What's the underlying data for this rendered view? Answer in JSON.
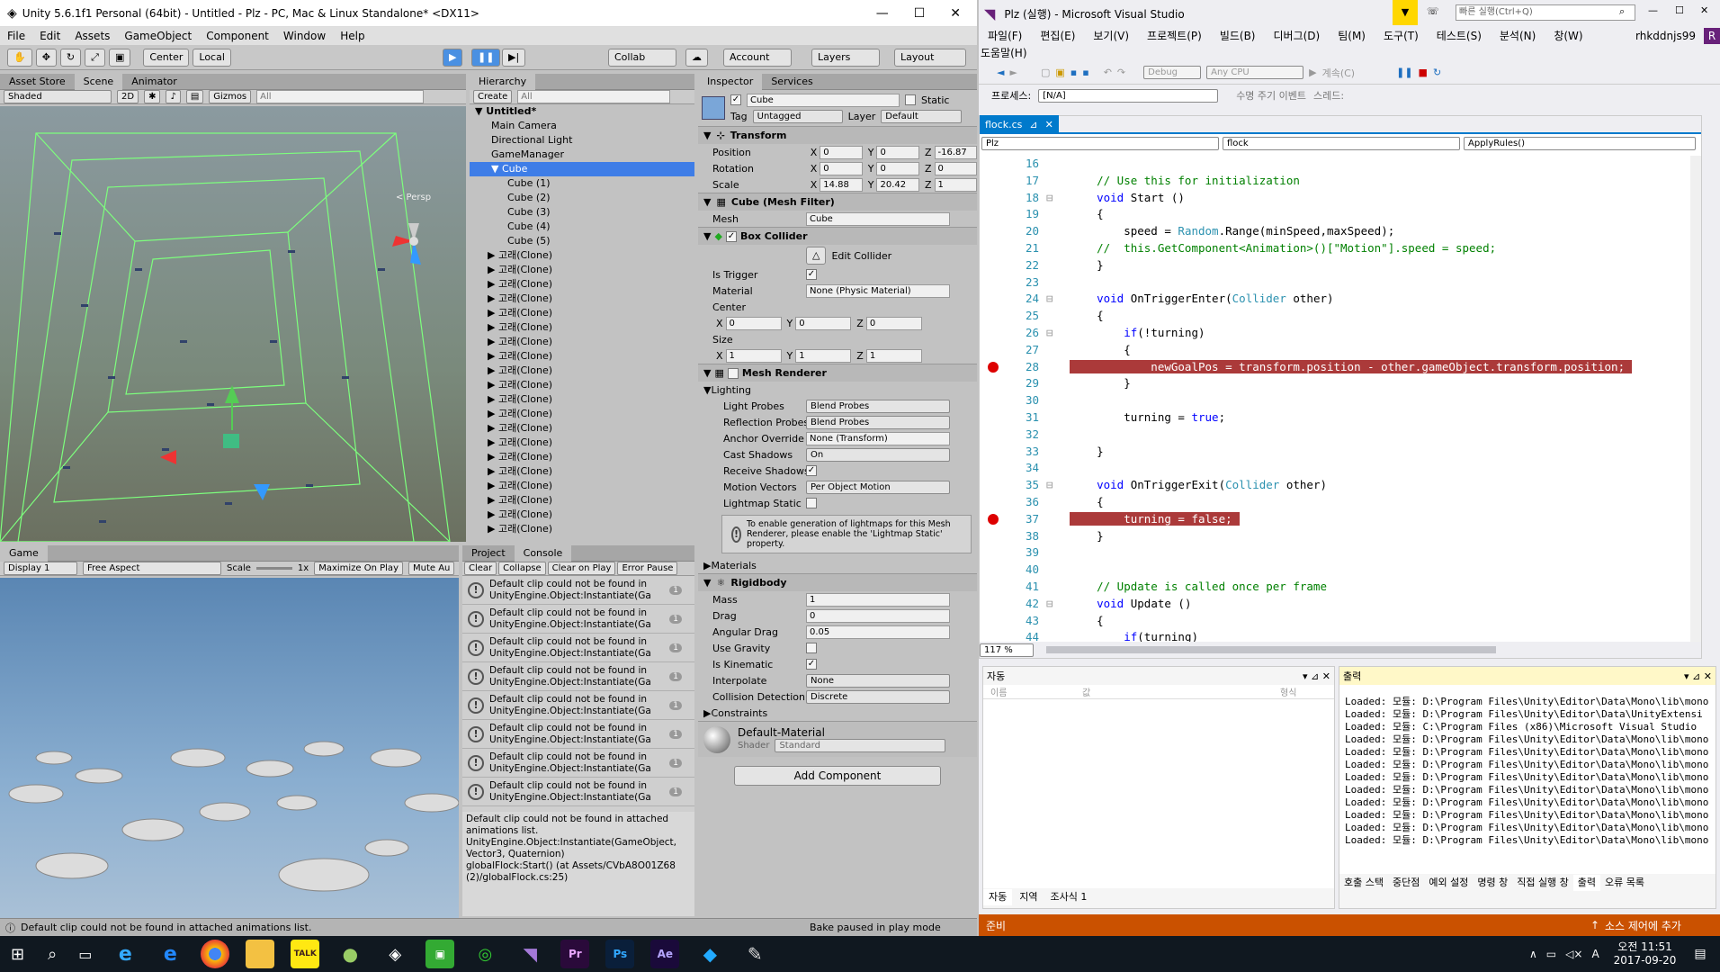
{
  "unity": {
    "title": "Unity 5.6.1f1 Personal (64bit) - Untitled - Plz - PC, Mac & Linux Standalone* <DX11>",
    "menu": [
      "File",
      "Edit",
      "Assets",
      "GameObject",
      "Component",
      "Window",
      "Help"
    ],
    "toolbar": {
      "center": "Center",
      "local": "Local",
      "collab": "Collab",
      "account": "Account",
      "layers": "Layers",
      "layout": "Layout"
    },
    "scene": {
      "tabs": [
        "Asset Store",
        "Scene",
        "Animator"
      ],
      "shaded": "Shaded",
      "mode2d": "2D",
      "gizmos": "Gizmos",
      "search_ph": "All",
      "persp": "< Persp"
    },
    "game": {
      "tab": "Game",
      "display": "Display 1",
      "aspect": "Free Aspect",
      "scale_label": "Scale",
      "scale_val": "1x",
      "max": "Maximize On Play",
      "mute": "Mute Au"
    },
    "hierarchy": {
      "tab": "Hierarchy",
      "create": "Create",
      "search_ph": "All",
      "scene": "Untitled*",
      "items": [
        "Main Camera",
        "Directional Light",
        "GameManager",
        "Cube",
        "Cube (1)",
        "Cube (2)",
        "Cube (3)",
        "Cube (4)",
        "Cube (5)",
        "고래(Clone)",
        "고래(Clone)",
        "고래(Clone)",
        "고래(Clone)",
        "고래(Clone)",
        "고래(Clone)",
        "고래(Clone)",
        "고래(Clone)",
        "고래(Clone)",
        "고래(Clone)",
        "고래(Clone)",
        "고래(Clone)",
        "고래(Clone)",
        "고래(Clone)",
        "고래(Clone)",
        "고래(Clone)",
        "고래(Clone)",
        "고래(Clone)",
        "고래(Clone)",
        "고래(Clone)"
      ]
    },
    "console": {
      "tabs": [
        "Project",
        "Console"
      ],
      "buttons": [
        "Clear",
        "Collapse",
        "Clear on Play",
        "Error Pause"
      ],
      "entries": [
        {
          "l1": "Default clip could not be found in",
          "l2": "UnityEngine.Object:Instantiate(Ga",
          "n": "1"
        },
        {
          "l1": "Default clip could not be found in",
          "l2": "UnityEngine.Object:Instantiate(Ga",
          "n": "1"
        },
        {
          "l1": "Default clip could not be found in",
          "l2": "UnityEngine.Object:Instantiate(Ga",
          "n": "1"
        },
        {
          "l1": "Default clip could not be found in",
          "l2": "UnityEngine.Object:Instantiate(Ga",
          "n": "1"
        },
        {
          "l1": "Default clip could not be found in",
          "l2": "UnityEngine.Object:Instantiate(Ga",
          "n": "1"
        },
        {
          "l1": "Default clip could not be found in",
          "l2": "UnityEngine.Object:Instantiate(Ga",
          "n": "1"
        },
        {
          "l1": "Default clip could not be found in",
          "l2": "UnityEngine.Object:Instantiate(Ga",
          "n": "1"
        },
        {
          "l1": "Default clip could not be found in",
          "l2": "UnityEngine.Object:Instantiate(Ga",
          "n": "1"
        }
      ],
      "detail": [
        "Default clip could not be found in attached",
        "animations list.",
        "UnityEngine.Object:Instantiate(GameObject,",
        "Vector3, Quaternion)",
        "globalFlock:Start() (at Assets/CVbA8O01Z68",
        "(2)/globalFlock.cs:25)"
      ]
    },
    "inspector": {
      "tabs": [
        "Inspector",
        "Services"
      ],
      "name": "Cube",
      "static": "Static",
      "tag_label": "Tag",
      "tag": "Untagged",
      "layer_label": "Layer",
      "layer": "Default",
      "transform": {
        "title": "Transform",
        "pos_label": "Position",
        "rot_label": "Rotation",
        "scale_label": "Scale",
        "pos": [
          "0",
          "0",
          "-16.87"
        ],
        "rot": [
          "0",
          "0",
          "0"
        ],
        "scale": [
          "14.88",
          "20.42",
          "1"
        ]
      },
      "meshfilter": {
        "title": "Cube (Mesh Filter)",
        "mesh_label": "Mesh",
        "mesh": "Cube"
      },
      "boxcollider": {
        "title": "Box Collider",
        "edit": "Edit Collider",
        "trigger_label": "Is Trigger",
        "material_label": "Material",
        "material": "None (Physic Material)",
        "center_label": "Center",
        "center": [
          "0",
          "0",
          "0"
        ],
        "size_label": "Size",
        "size": [
          "1",
          "1",
          "1"
        ]
      },
      "meshrenderer": {
        "title": "Mesh Renderer",
        "lighting": "Lighting",
        "lp_label": "Light Probes",
        "lp": "Blend Probes",
        "rp_label": "Reflection Probes",
        "rp": "Blend Probes",
        "ao_label": "Anchor Override",
        "ao": "None (Transform)",
        "cs_label": "Cast Shadows",
        "cs": "On",
        "rs_label": "Receive Shadows",
        "mv_label": "Motion Vectors",
        "mv": "Per Object Motion",
        "ls_label": "Lightmap Static",
        "info": "To enable generation of lightmaps for this Mesh Renderer, please enable the 'Lightmap Static' property.",
        "materials": "Materials"
      },
      "rigidbody": {
        "title": "Rigidbody",
        "mass_label": "Mass",
        "mass": "1",
        "drag_label": "Drag",
        "drag": "0",
        "adrag_label": "Angular Drag",
        "adrag": "0.05",
        "grav_label": "Use Gravity",
        "kin_label": "Is Kinematic",
        "interp_label": "Interpolate",
        "interp": "None",
        "cd_label": "Collision Detection",
        "cd": "Discrete",
        "constraints": "Constraints"
      },
      "material": {
        "name": "Default-Material",
        "shader_label": "Shader",
        "shader": "Standard"
      },
      "add": "Add Component"
    },
    "status": {
      "msg": "Default clip could not be found in attached animations list.",
      "bake": "Bake paused in play mode"
    }
  },
  "vs": {
    "title": "Plz (실행) - Microsoft Visual Studio",
    "quick_ph": "빠른 실행(Ctrl+Q)",
    "user": "rhkddnjs99",
    "menu": [
      "파일(F)",
      "편집(E)",
      "보기(V)",
      "프로젝트(P)",
      "빌드(B)",
      "디버그(D)",
      "팀(M)",
      "도구(T)",
      "테스트(S)",
      "분석(N)",
      "창(W)"
    ],
    "menu2": "도움말(H)",
    "toolbar": {
      "config": "Debug",
      "platform": "Any CPU",
      "continue": "계속(C)"
    },
    "process": {
      "label": "프로세스:",
      "value": "[N/A]",
      "lifecycle": "수명 주기 이벤트",
      "thread": "스레드:"
    },
    "tab": "flock.cs",
    "nav": {
      "project": "Plz",
      "class": "flock",
      "method": "ApplyRules()"
    },
    "zoom": "117 %",
    "code": [
      {
        "n": "16",
        "t": ""
      },
      {
        "n": "17",
        "t": "    // Use this for initialization"
      },
      {
        "n": "18",
        "t": "    void Start ()"
      },
      {
        "n": "19",
        "t": "    {"
      },
      {
        "n": "20",
        "t": "        speed = Random.Range(minSpeed,maxSpeed);"
      },
      {
        "n": "21",
        "t": "    //  this.GetComponent<Animation>()[\"Motion\"].speed = speed;"
      },
      {
        "n": "22",
        "t": "    }"
      },
      {
        "n": "23",
        "t": ""
      },
      {
        "n": "24",
        "t": "    void OnTriggerEnter(Collider other)"
      },
      {
        "n": "25",
        "t": "    {"
      },
      {
        "n": "26",
        "t": "        if(!turning)"
      },
      {
        "n": "27",
        "t": "        {"
      },
      {
        "n": "28",
        "t": "            newGoalPos = transform.position - other.gameObject.transform.position;"
      },
      {
        "n": "29",
        "t": "        }"
      },
      {
        "n": "30",
        "t": ""
      },
      {
        "n": "31",
        "t": "        turning = true;"
      },
      {
        "n": "32",
        "t": ""
      },
      {
        "n": "33",
        "t": "    }"
      },
      {
        "n": "34",
        "t": ""
      },
      {
        "n": "35",
        "t": "    void OnTriggerExit(Collider other)"
      },
      {
        "n": "36",
        "t": "    {"
      },
      {
        "n": "37",
        "t": "        turning = false;"
      },
      {
        "n": "38",
        "t": "    }"
      },
      {
        "n": "39",
        "t": ""
      },
      {
        "n": "40",
        "t": ""
      },
      {
        "n": "41",
        "t": "    // Update is called once per frame"
      },
      {
        "n": "42",
        "t": "    void Update ()"
      },
      {
        "n": "43",
        "t": "    {"
      },
      {
        "n": "44",
        "t": "        if(turning)"
      }
    ],
    "auto": {
      "title": "자동",
      "cols": [
        "이름",
        "값",
        "형식"
      ],
      "tabs": [
        "자동",
        "지역",
        "조사식 1"
      ]
    },
    "output": {
      "title": "출력",
      "lines": [
        "Loaded: 모듈: D:\\Program Files\\Unity\\Editor\\Data\\Mono\\lib\\mono",
        "Loaded: 모듈: D:\\Program Files\\Unity\\Editor\\Data\\UnityExtensi",
        "Loaded: 모듈: C:\\Program Files (x86)\\Microsoft Visual Studio",
        "Loaded: 모듈: D:\\Program Files\\Unity\\Editor\\Data\\Mono\\lib\\mono",
        "Loaded: 모듈: D:\\Program Files\\Unity\\Editor\\Data\\Mono\\lib\\mono",
        "Loaded: 모듈: D:\\Program Files\\Unity\\Editor\\Data\\Mono\\lib\\mono",
        "Loaded: 모듈: D:\\Program Files\\Unity\\Editor\\Data\\Mono\\lib\\mono",
        "Loaded: 모듈: D:\\Program Files\\Unity\\Editor\\Data\\Mono\\lib\\mono",
        "Loaded: 모듈: D:\\Program Files\\Unity\\Editor\\Data\\Mono\\lib\\mono",
        "Loaded: 모듈: D:\\Program Files\\Unity\\Editor\\Data\\Mono\\lib\\mono",
        "Loaded: 모듈: D:\\Program Files\\Unity\\Editor\\Data\\Mono\\lib\\mono",
        "Loaded: 모듈: D:\\Program Files\\Unity\\Editor\\Data\\Mono\\lib\\mono"
      ],
      "tabs": [
        "호출 스택",
        "중단점",
        "예외 설정",
        "명령 창",
        "직접 실행 창",
        "출력",
        "오류 목록"
      ]
    },
    "status": {
      "ready": "준비",
      "source": "소스 제어에 추가"
    }
  },
  "taskbar": {
    "time": "오전 11:51",
    "date": "2017-09-20",
    "lang": "A"
  }
}
